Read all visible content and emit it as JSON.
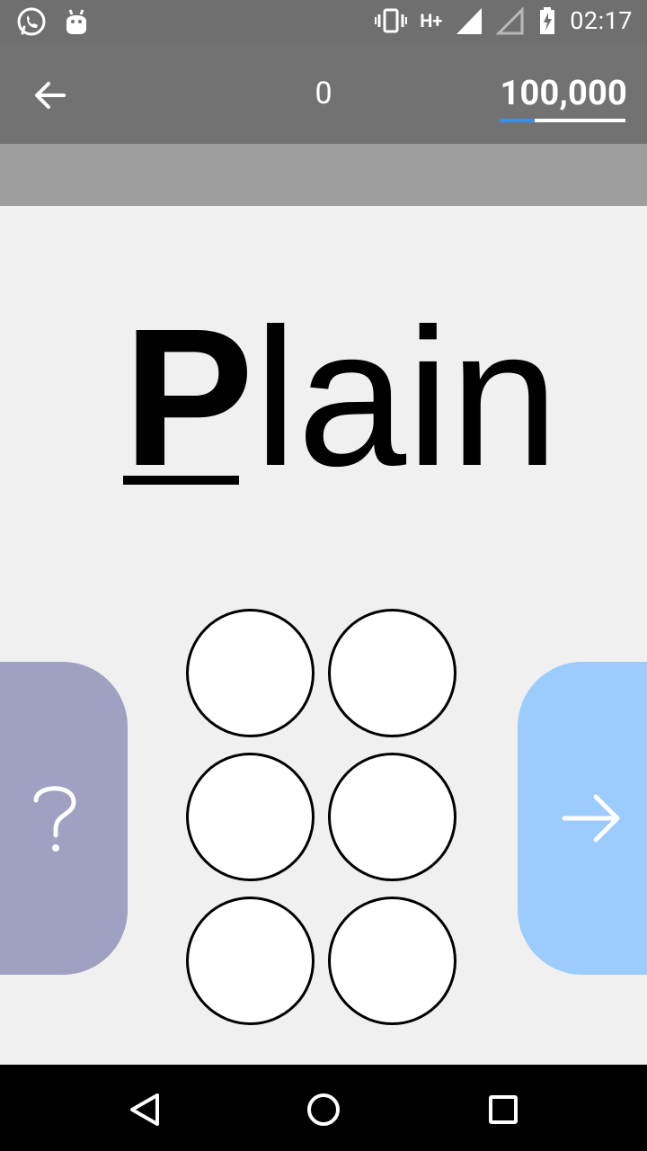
{
  "status_bar": {
    "time": "02:17",
    "network": "H+",
    "icons": [
      "whatsapp-icon",
      "android-icon",
      "vibrate-icon",
      "signal-icon",
      "signal-empty-icon",
      "battery-charging-icon"
    ]
  },
  "header": {
    "score": "0",
    "goal": "100,000",
    "progress": 0.28,
    "accent_color": "#3b8eea"
  },
  "lesson": {
    "word_first": "P",
    "word_rest": "lain"
  },
  "braille": {
    "dots": [
      false,
      false,
      false,
      false,
      false,
      false
    ]
  },
  "buttons": {
    "help": "?",
    "help_color": "#9fa0c2",
    "next_color": "#9ccbfd"
  },
  "navigation": {
    "icons": [
      "back-triangle-icon",
      "home-circle-icon",
      "recents-square-icon"
    ]
  }
}
